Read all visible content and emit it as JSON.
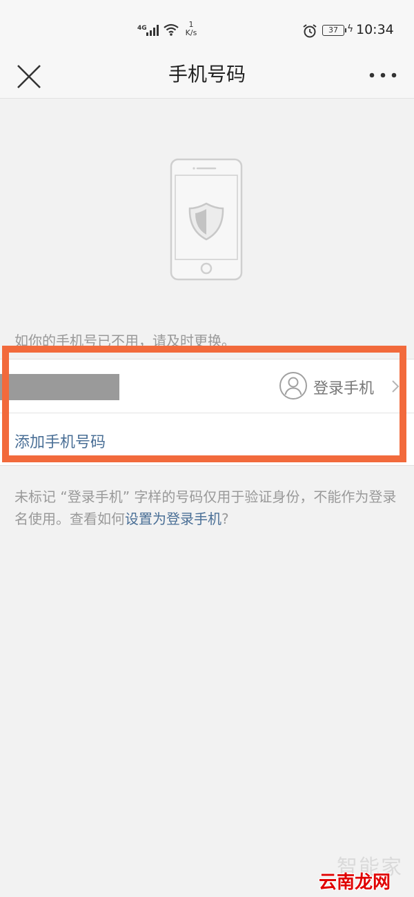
{
  "status_bar": {
    "network": "4G",
    "speed_value": "1",
    "speed_unit": "K/s",
    "battery": "37",
    "time": "10:34"
  },
  "nav": {
    "title": "手机号码",
    "close_icon": "close-icon",
    "more_icon": "more-icon"
  },
  "illustration": {
    "icon": "phone-shield-icon"
  },
  "hint": "如你的手机号已不用，请及时更换。",
  "phone_list": {
    "login_label": "登录手机",
    "add_label": "添加手机号码"
  },
  "note": {
    "text": "未标记 “登录手机” 字样的号码仅用于验证身份，不能作为登录名使用。查看如何",
    "link": "设置为登录手机",
    "suffix": "?"
  },
  "watermark": {
    "top": "智能家",
    "bottom": "云南龙网"
  },
  "colors": {
    "accent_link": "#4a6f96",
    "highlight": "#f26a3c",
    "background": "#f2f2f2"
  }
}
